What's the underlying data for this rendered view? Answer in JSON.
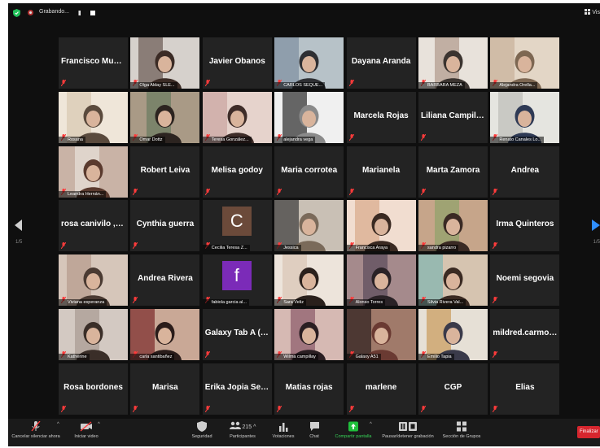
{
  "topbar": {
    "recording_label": "Grabando...",
    "pause_glyph": "II",
    "view_label": "Vis"
  },
  "participants": [
    {
      "name": "Francisco Muño...",
      "video": false,
      "active": false
    },
    {
      "name": "",
      "label": "Olga Alday SLE...",
      "video": true,
      "palette": [
        "#6a5a52",
        "#3b2b25",
        "#d6d1cc"
      ],
      "active": false
    },
    {
      "name": "Javier Obanos",
      "video": false,
      "active": false
    },
    {
      "name": "",
      "label": "CARLOS SEQUE...",
      "video": true,
      "palette": [
        "#7d8fa0",
        "#2e2f33",
        "#b7c2c8"
      ],
      "active": false
    },
    {
      "name": "Dayana Aranda",
      "video": false,
      "active": false
    },
    {
      "name": "",
      "label": "BARBARA MEZA",
      "video": true,
      "palette": [
        "#b19a8c",
        "#3b3430",
        "#e8e2db"
      ],
      "active": false
    },
    {
      "name": "",
      "label": "Alejandra Orella...",
      "video": true,
      "palette": [
        "#c8b09a",
        "#7d6752",
        "#e3d6c6"
      ],
      "active": false
    },
    {
      "name": "",
      "label": "Rosana",
      "video": true,
      "palette": [
        "#d8c7b0",
        "#5a4a3d",
        "#efe6d9"
      ],
      "active": false
    },
    {
      "name": "",
      "label": "Omar Dottz",
      "video": true,
      "palette": [
        "#6a7a60",
        "#2c2420",
        "#a99a86"
      ],
      "active": false
    },
    {
      "name": "",
      "label": "Teresa González...",
      "video": true,
      "palette": [
        "#c9a4a0",
        "#3e2c28",
        "#e6d3cc"
      ],
      "active": false
    },
    {
      "name": "",
      "label": "alejandra vega",
      "video": true,
      "palette": [
        "#2a2a2a",
        "#8a8a8a",
        "#f0f0f0"
      ],
      "active": false
    },
    {
      "name": "Marcela Rojas",
      "video": false,
      "active": false
    },
    {
      "name": "Liliana Campillay",
      "video": false,
      "active": false
    },
    {
      "name": "",
      "label": "Renato Canales Lo...",
      "video": true,
      "palette": [
        "#bdbdb8",
        "#2e3a55",
        "#e5e5e0"
      ],
      "active": true
    },
    {
      "name": "",
      "label": "Leandra Hernán...",
      "video": true,
      "palette": [
        "#e8e2dc",
        "#5a3a2e",
        "#c9b3a6"
      ],
      "active": false
    },
    {
      "name": "Robert Leiva",
      "video": false,
      "active": false
    },
    {
      "name": "Melisa godoy",
      "video": false,
      "active": false
    },
    {
      "name": "Maria corrotea",
      "video": false,
      "active": false
    },
    {
      "name": "Marianela",
      "video": false,
      "active": false
    },
    {
      "name": "Marta Zamora",
      "video": false,
      "active": false
    },
    {
      "name": "Andrea",
      "video": false,
      "active": false
    },
    {
      "name": "rosa canivilo , g...",
      "video": false,
      "active": false
    },
    {
      "name": "Cynthia guerra",
      "video": false,
      "active": false
    },
    {
      "name": "",
      "label": "Cecilia Teresa Z...",
      "avatar": "C",
      "avatar_color": "#6b4a3a",
      "active": false
    },
    {
      "name": "",
      "label": "Jessica",
      "video": true,
      "palette": [
        "#3a3a3a",
        "#7a6a5a",
        "#c9c0b5"
      ],
      "active": false
    },
    {
      "name": "",
      "label": "Francisca Araya",
      "video": true,
      "palette": [
        "#d9a98a",
        "#3a2a22",
        "#f1ddd0"
      ],
      "active": false
    },
    {
      "name": "",
      "label": "sandra pizarro",
      "video": true,
      "palette": [
        "#8fa36a",
        "#3a2a24",
        "#c6a58a"
      ],
      "active": false
    },
    {
      "name": "Irma Quinteros",
      "video": false,
      "active": false
    },
    {
      "name": "",
      "label": "Viviana esperanza",
      "video": true,
      "palette": [
        "#b59a8c",
        "#4a3a32",
        "#d6c6ba"
      ],
      "active": false
    },
    {
      "name": "Andrea Rivera",
      "video": false,
      "active": false
    },
    {
      "name": "",
      "label": "fabiola garcia al...",
      "avatar": "f",
      "avatar_color": "#7b2bb8",
      "active": false
    },
    {
      "name": "",
      "label": "Sara Veliz",
      "video": true,
      "palette": [
        "#d9c5b5",
        "#2a201c",
        "#ede4db"
      ],
      "active": false
    },
    {
      "name": "",
      "label": "Alonso Torres",
      "video": true,
      "palette": [
        "#5a4a5a",
        "#2a2226",
        "#a58a8c"
      ],
      "active": false
    },
    {
      "name": "",
      "label": "Silvia Rivera Val...",
      "video": true,
      "palette": [
        "#7fb5b0",
        "#3a2a22",
        "#d6c4b0"
      ],
      "active": false
    },
    {
      "name": "Noemi segovia",
      "video": false,
      "active": false
    },
    {
      "name": "",
      "label": "Katherine",
      "video": true,
      "palette": [
        "#a89a92",
        "#3a2e28",
        "#d3c9c2"
      ],
      "active": false
    },
    {
      "name": "",
      "label": "carla santibañez",
      "video": true,
      "palette": [
        "#7a2a2a",
        "#2a1c1a",
        "#c9a896"
      ],
      "active": false
    },
    {
      "name": "Galaxy Tab A (8....",
      "video": false,
      "active": false
    },
    {
      "name": "",
      "label": "Wilma campillay",
      "video": true,
      "palette": [
        "#8a5a6a",
        "#2a1e22",
        "#d6b9b3"
      ],
      "active": false
    },
    {
      "name": "",
      "label": "Galaxy A51",
      "video": true,
      "palette": [
        "#2a1c1c",
        "#6a3a32",
        "#a07a6a"
      ],
      "active": false
    },
    {
      "name": "",
      "label": "Emilio Tapia",
      "video": true,
      "palette": [
        "#c99a5a",
        "#3a3a4a",
        "#e6e0d6"
      ],
      "active": false
    },
    {
      "name": "mildred.carmon...",
      "video": false,
      "active": false
    },
    {
      "name": "Rosa bordones",
      "video": false,
      "active": false
    },
    {
      "name": "Marisa",
      "video": false,
      "active": false
    },
    {
      "name": "Erika Jopia Seura",
      "video": false,
      "active": false
    },
    {
      "name": "Matias rojas",
      "video": false,
      "active": false
    },
    {
      "name": "marlene",
      "video": false,
      "active": false
    },
    {
      "name": "CGP",
      "video": false,
      "active": false
    },
    {
      "name": "Elias",
      "video": false,
      "active": false
    }
  ],
  "pagination": {
    "left": "1/5",
    "right": "1/5"
  },
  "toolbar": {
    "mute": "Cancelar silenciar ahora",
    "video": "Iniciar video",
    "security": "Seguridad",
    "participants": "Participantes",
    "participants_count": "215",
    "polls": "Votaciones",
    "chat": "Chat",
    "share": "Compartir pantalla",
    "record": "Pausar/detener grabación",
    "rooms": "Sección de Grupos",
    "end": "Finalizar"
  },
  "colors": {
    "mic_muted": "#ff3b3b",
    "active_border": "#e6e34a",
    "share_green": "#1fbf3b",
    "end_red": "#d6262e",
    "arrow_blue": "#2f8fff"
  }
}
